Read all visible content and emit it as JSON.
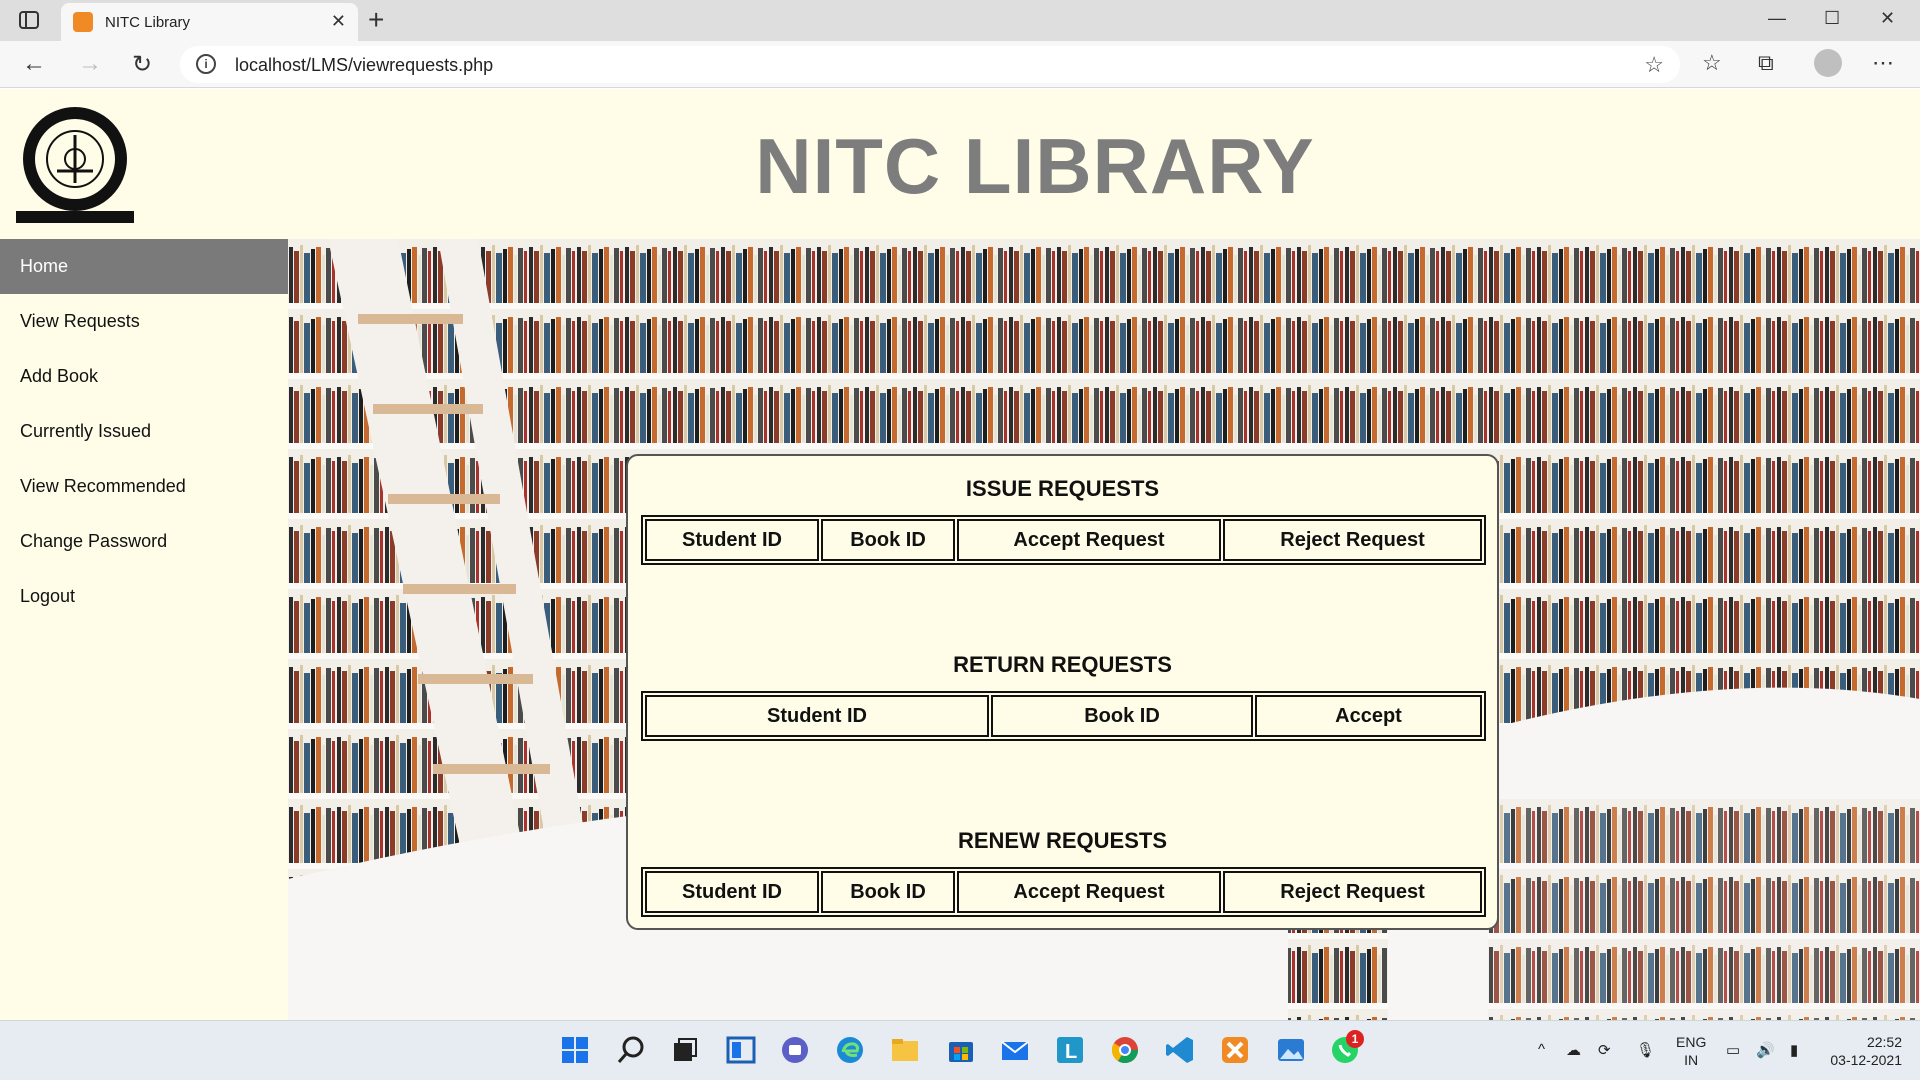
{
  "browser": {
    "tab_title": "NITC Library",
    "tab_close": "✕",
    "new_tab": "+",
    "url": "localhost/LMS/viewrequests.php",
    "window_controls": [
      "—",
      "☐",
      "✕"
    ]
  },
  "header": {
    "title": "NITC LIBRARY",
    "logo_icon": "nitc-emblem-icon"
  },
  "sidebar": {
    "items": [
      {
        "label": "Home",
        "active": true
      },
      {
        "label": "View Requests"
      },
      {
        "label": "Add Book"
      },
      {
        "label": "Currently Issued"
      },
      {
        "label": "View Recommended"
      },
      {
        "label": "Change Password"
      },
      {
        "label": "Logout"
      }
    ]
  },
  "issue_requests": {
    "title": "ISSUE REQUESTS",
    "columns": [
      "Student ID",
      "Book ID",
      "Accept Request",
      "Reject Request"
    ]
  },
  "return_requests": {
    "title": "RETURN REQUESTS",
    "columns": [
      "Student ID",
      "Book ID",
      "Accept"
    ]
  },
  "renew_requests": {
    "title": "RENEW REQUESTS",
    "columns": [
      "Student ID",
      "Book ID",
      "Accept Request",
      "Reject Request"
    ]
  },
  "taskbar": {
    "language": [
      "ENG",
      "IN"
    ],
    "time": "22:52",
    "date": "03-12-2021",
    "whatsapp_badge": "1"
  },
  "colors": {
    "page_bg": "#fffde8",
    "active_nav": "#7a7a7a",
    "title_gray": "#7d7d7d"
  }
}
